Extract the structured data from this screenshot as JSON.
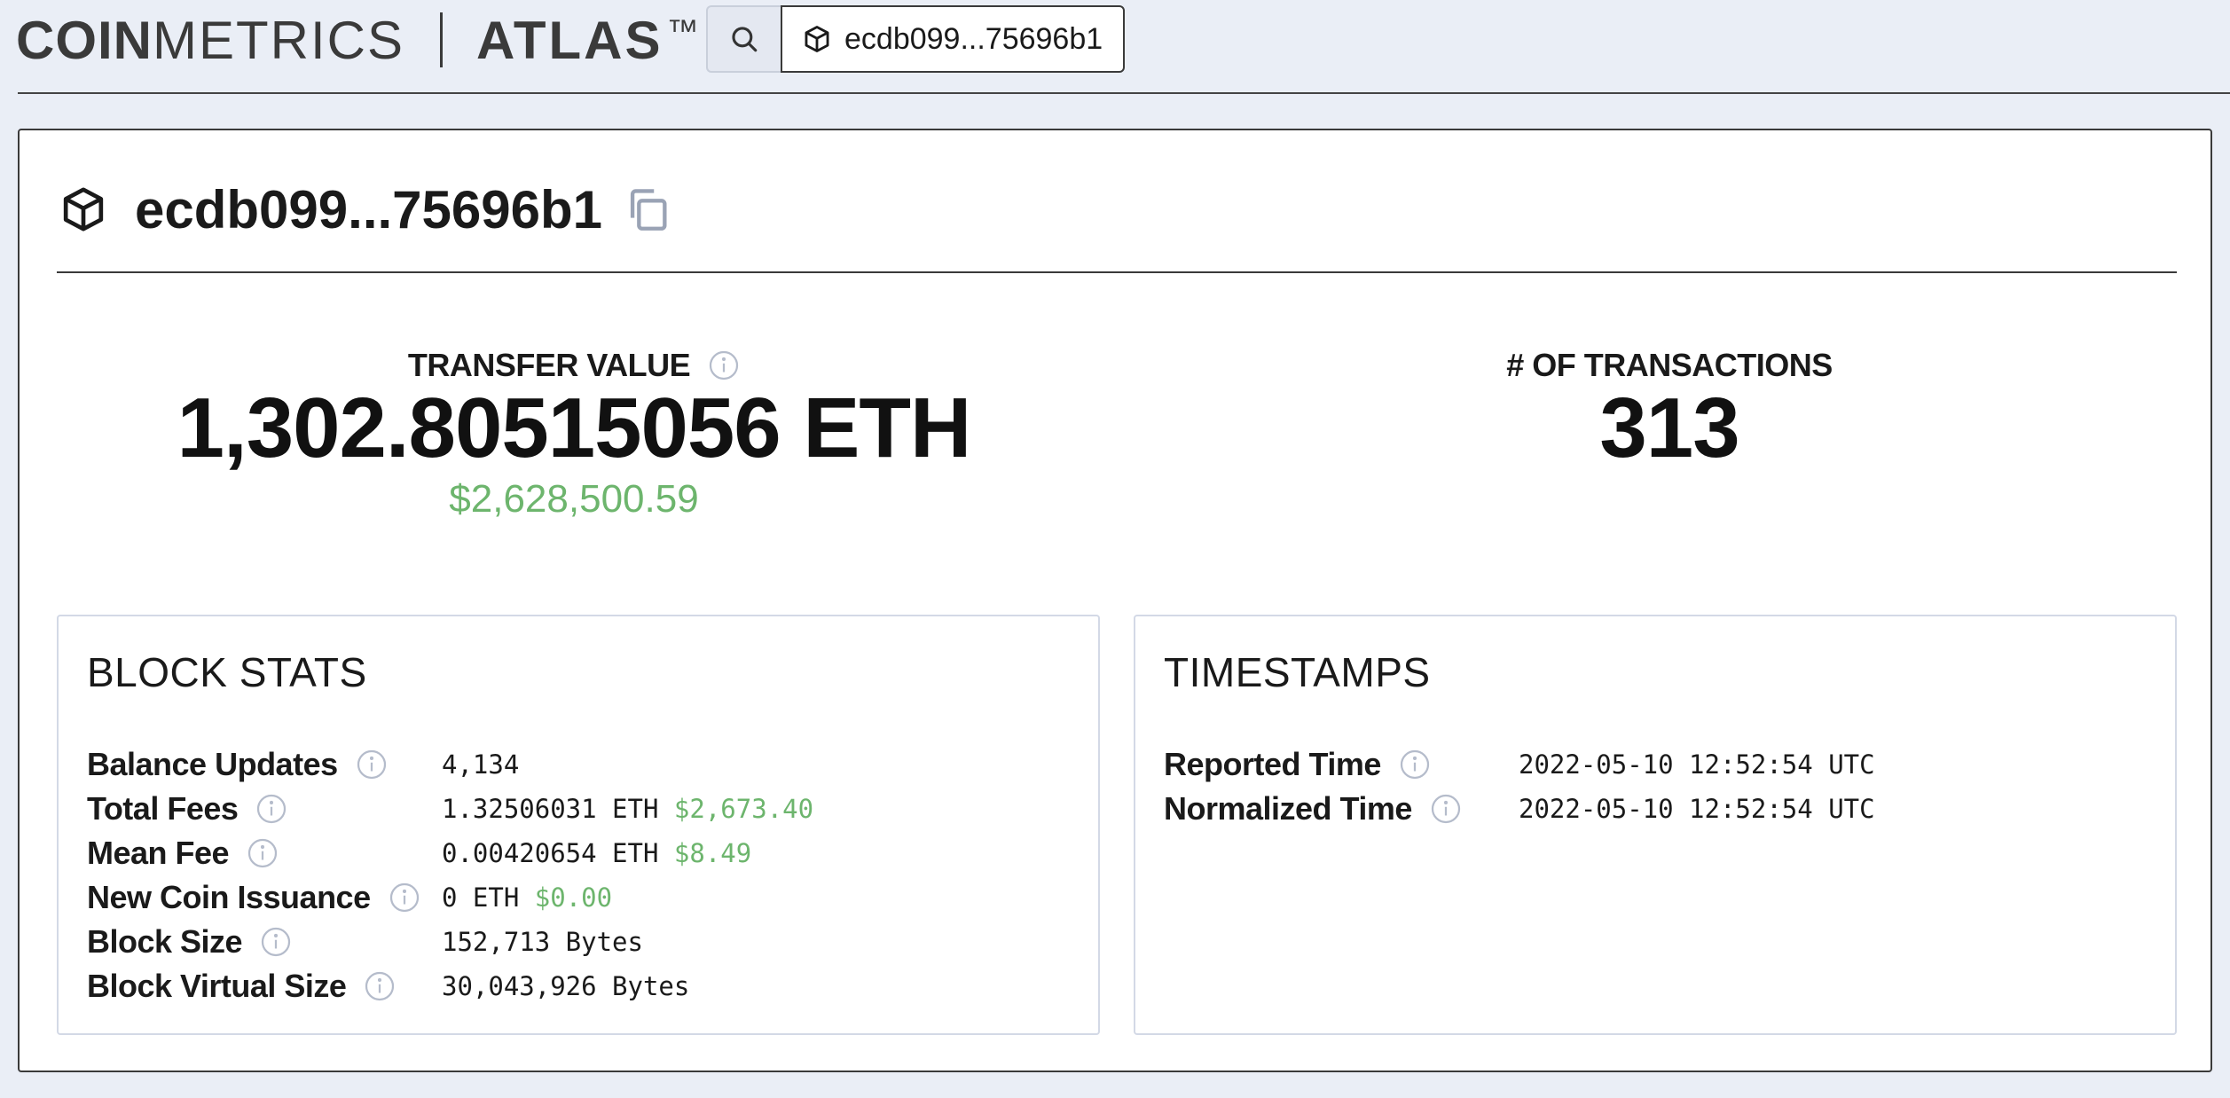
{
  "header": {
    "logo_coin": "COIN",
    "logo_metrics": "METRICS",
    "logo_atlas": "ATLAS",
    "logo_tm": "™",
    "search_value": "ecdb099...75696b1"
  },
  "block": {
    "title": "ecdb099...75696b1"
  },
  "metrics": {
    "transfer_label": "TRANSFER VALUE",
    "transfer_value": "1,302.80515056 ETH",
    "transfer_usd": "$2,628,500.59",
    "tx_label": "# OF TRANSACTIONS",
    "tx_value": "313"
  },
  "block_stats": {
    "title": "BLOCK STATS",
    "rows": [
      {
        "label": "Balance Updates",
        "value": "4,134",
        "usd": ""
      },
      {
        "label": "Total Fees",
        "value": "1.32506031 ETH",
        "usd": "$2,673.40"
      },
      {
        "label": "Mean Fee",
        "value": "0.00420654 ETH",
        "usd": "$8.49"
      },
      {
        "label": "New Coin Issuance",
        "value": "0 ETH",
        "usd": "$0.00"
      },
      {
        "label": "Block Size",
        "value": "152,713 Bytes",
        "usd": ""
      },
      {
        "label": "Block Virtual Size",
        "value": "30,043,926 Bytes",
        "usd": ""
      }
    ]
  },
  "timestamps": {
    "title": "TIMESTAMPS",
    "rows": [
      {
        "label": "Reported Time",
        "value": "2022-05-10 12:52:54 UTC"
      },
      {
        "label": "Normalized Time",
        "value": "2022-05-10 12:52:54 UTC"
      }
    ]
  },
  "colors": {
    "background": "#eaeef6",
    "usd_green": "#6db56d",
    "text": "#1a1a1a"
  },
  "icons": {
    "search": "search-icon",
    "block": "cube-icon",
    "copy": "copy-icon",
    "info": "info-icon"
  }
}
